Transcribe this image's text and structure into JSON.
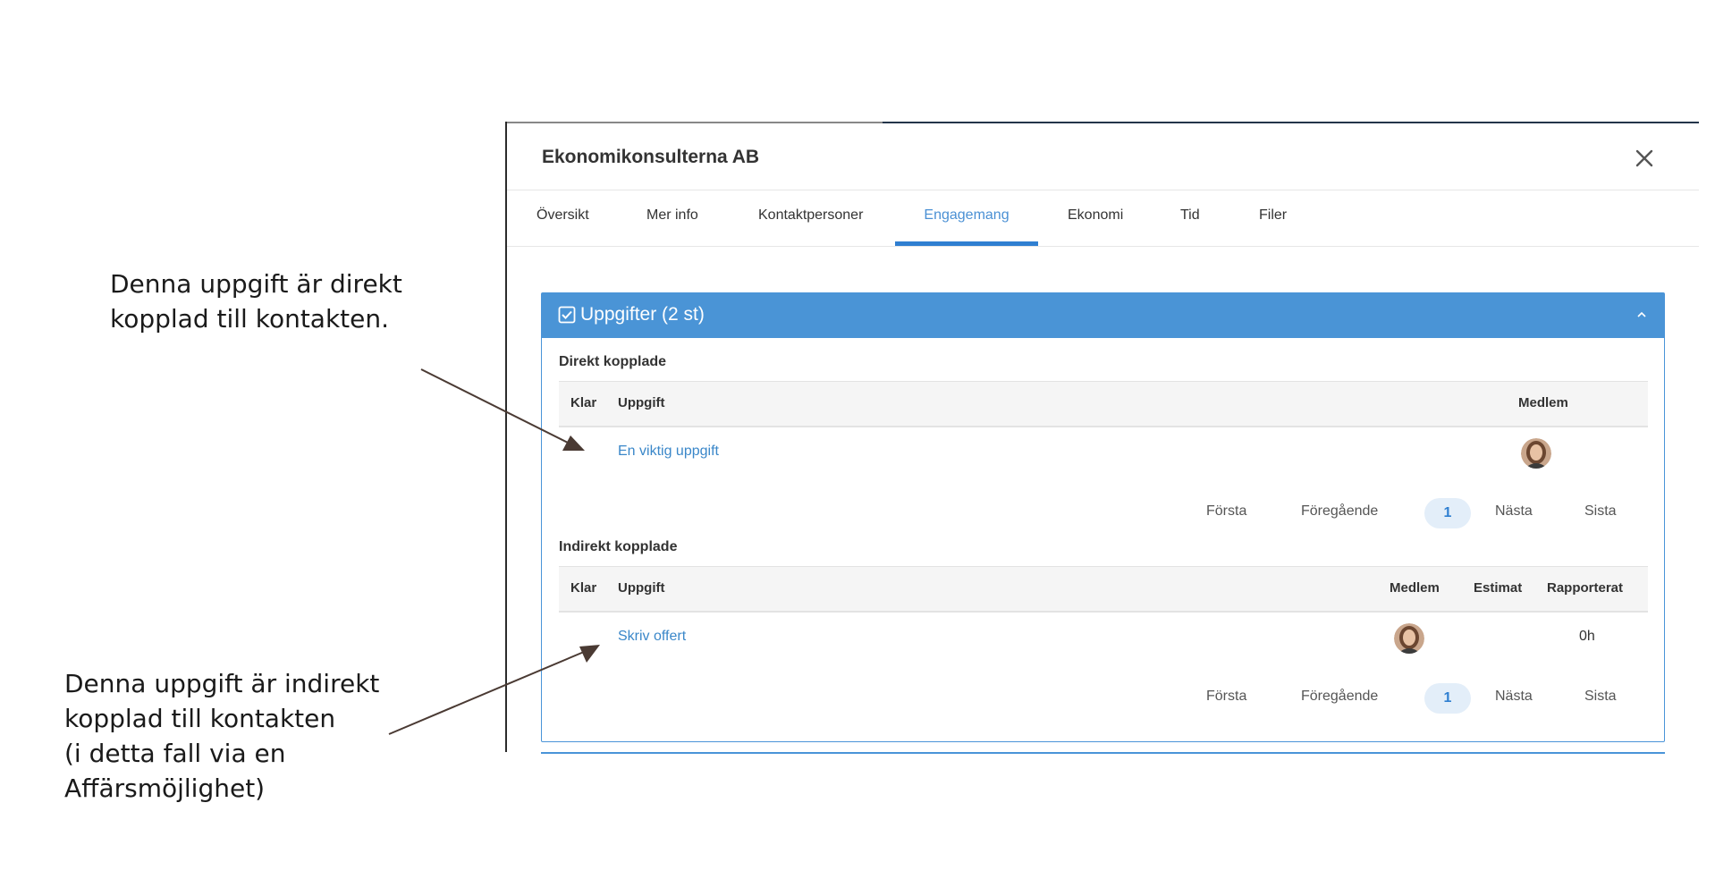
{
  "annotations": {
    "direct": [
      "Denna uppgift är direkt",
      "kopplad till kontakten."
    ],
    "indirect": [
      "Denna uppgift är indirekt",
      "kopplad till kontakten",
      "(i detta fall via en",
      "Affärsmöjlighet)"
    ]
  },
  "dialog": {
    "title": "Ekonomikonsulterna AB",
    "close_icon": "close-icon",
    "tabs": [
      "Översikt",
      "Mer info",
      "Kontaktpersoner",
      "Engagemang",
      "Ekonomi",
      "Tid",
      "Filer"
    ],
    "active_tab": "Engagemang"
  },
  "tasks_panel": {
    "title": "Uppgifter (2 st)",
    "header_icon": "checkbox-icon",
    "collapse_icon": "chevron-up-icon",
    "header_color": "#4a94d6",
    "direct": {
      "label": "Direkt kopplade",
      "columns": [
        "Klar",
        "Uppgift",
        "Medlem"
      ],
      "rows": [
        {
          "task": "En viktig uppgift",
          "member_icon": "avatar-icon"
        }
      ],
      "pagination": {
        "first": "Första",
        "previous": "Föregående",
        "current": "1",
        "next": "Nästa",
        "last": "Sista"
      }
    },
    "indirect": {
      "label": "Indirekt kopplade",
      "columns": [
        "Klar",
        "Uppgift",
        "Medlem",
        "Estimat",
        "Rapporterat"
      ],
      "rows": [
        {
          "task": "Skriv offert",
          "member_icon": "avatar-icon",
          "estimate": "",
          "reported": "0h"
        }
      ],
      "pagination": {
        "first": "Första",
        "previous": "Föregående",
        "current": "1",
        "next": "Nästa",
        "last": "Sista"
      }
    }
  },
  "colors": {
    "accent": "#2f7fd1",
    "link": "#3a87c9",
    "panel_header": "#4a94d6",
    "arrow": "#4a3a33"
  }
}
